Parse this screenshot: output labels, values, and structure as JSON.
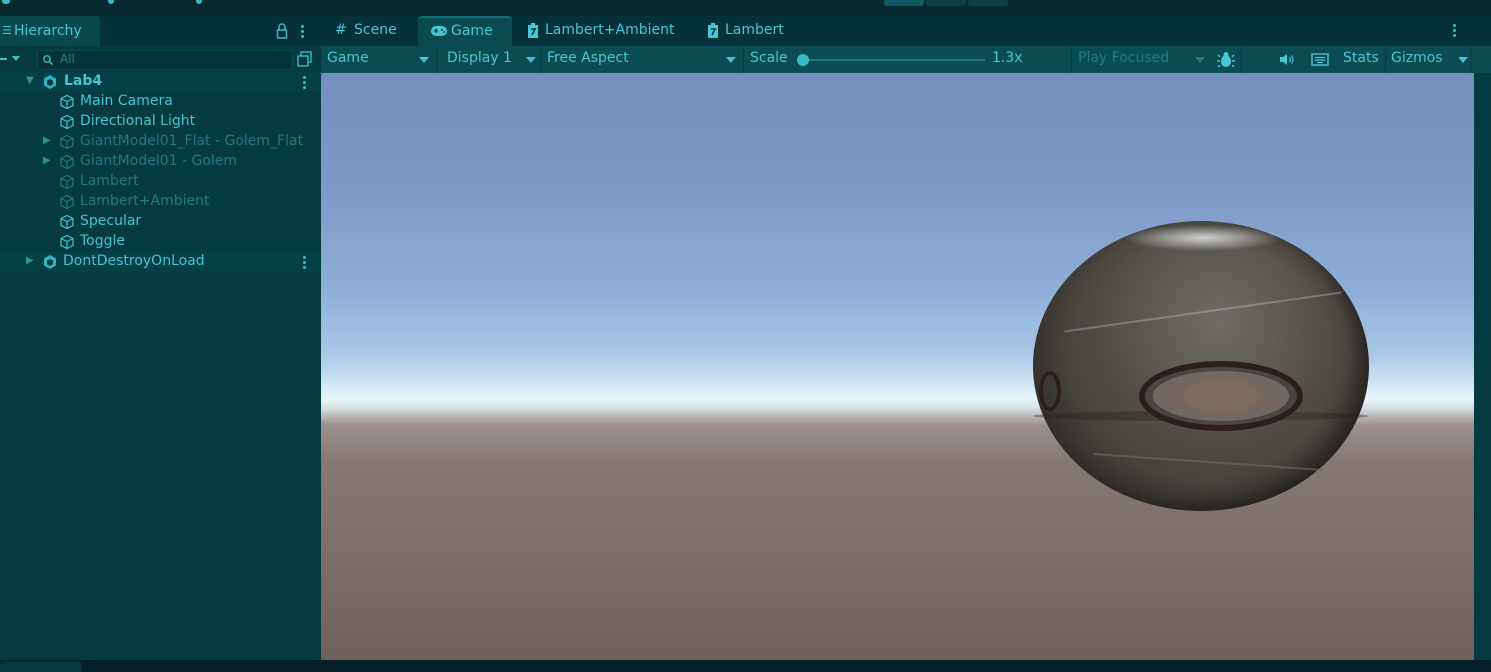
{
  "hierarchy": {
    "tab_label": "Hierarchy",
    "search_placeholder": "All",
    "scene": {
      "name": "Lab4",
      "children": [
        {
          "label": "Main Camera",
          "active": true,
          "expandable": false
        },
        {
          "label": "Directional Light",
          "active": true,
          "expandable": false
        },
        {
          "label": "GiantModel01_Flat - Golem_Flat",
          "active": false,
          "expandable": true
        },
        {
          "label": "GiantModel01 - Golem",
          "active": false,
          "expandable": true
        },
        {
          "label": "Lambert",
          "active": false,
          "expandable": false
        },
        {
          "label": "Lambert+Ambient",
          "active": false,
          "expandable": false
        },
        {
          "label": "Specular",
          "active": true,
          "expandable": false
        },
        {
          "label": "Toggle",
          "active": true,
          "expandable": false
        }
      ]
    },
    "dontdestroy": "DontDestroyOnLoad"
  },
  "tabs": [
    {
      "label": "Scene",
      "icon": "grid-icon"
    },
    {
      "label": "Game",
      "icon": "gamepad-icon",
      "active": true
    },
    {
      "label": "Lambert+Ambient",
      "icon": "shader-icon"
    },
    {
      "label": "Lambert",
      "icon": "shader-icon"
    }
  ],
  "game_toolbar": {
    "view": "Game",
    "display": "Display 1",
    "aspect": "Free Aspect",
    "scale_label": "Scale",
    "scale_value": "1.3x",
    "play_mode": "Play Focused",
    "stats": "Stats",
    "gizmos": "Gizmos"
  },
  "colors": {
    "panel_bg": "#053a40",
    "accent_text": "#45c8d4",
    "inactive_text": "#1f7a83"
  }
}
